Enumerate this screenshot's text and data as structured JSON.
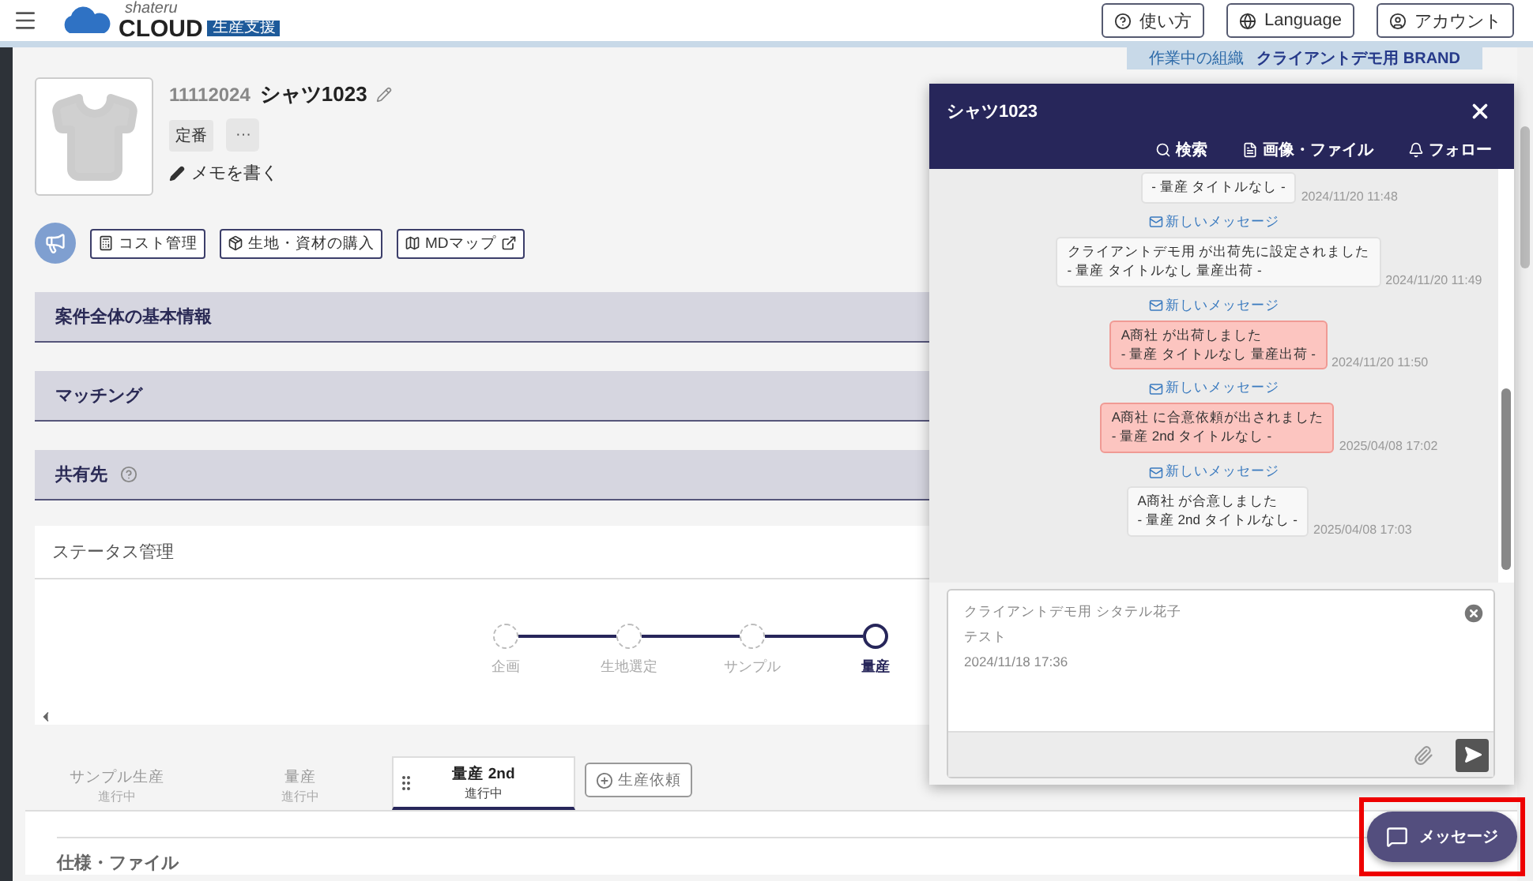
{
  "header": {
    "logo": {
      "small": "shateru",
      "main": "CLOUD",
      "badge": "生産支援"
    },
    "buttons": [
      {
        "kind": "help",
        "label": "使い方"
      },
      {
        "kind": "language",
        "label": "Language"
      },
      {
        "kind": "account",
        "label": "アカウント"
      }
    ]
  },
  "organization": {
    "label": "作業中の組織",
    "name": "クライアントデモ用 BRAND"
  },
  "product": {
    "code": "11112024",
    "name": "シャツ1023",
    "tag": "定番",
    "more": "···",
    "memo": "メモを書く"
  },
  "actions": [
    {
      "kind": "cost",
      "label": "コスト管理"
    },
    {
      "kind": "material",
      "label": "生地・資材の購入"
    },
    {
      "kind": "map",
      "label": "MDマップ"
    }
  ],
  "sections": [
    {
      "title": "案件全体の基本情報",
      "help": false
    },
    {
      "title": "マッチング",
      "help": false
    },
    {
      "title": "共有先",
      "help": true
    }
  ],
  "status": {
    "title": "ステータス管理",
    "steps": [
      {
        "label": "企画",
        "current": false
      },
      {
        "label": "生地選定",
        "current": false
      },
      {
        "label": "サンプル",
        "current": false
      },
      {
        "label": "量産",
        "current": true
      }
    ]
  },
  "phase_tabs": [
    {
      "title": "サンプル生産",
      "state": "進行中",
      "selected": false
    },
    {
      "title": "量産",
      "state": "進行中",
      "selected": false
    },
    {
      "title": "量産 2nd",
      "state": "進行中",
      "selected": true
    }
  ],
  "add_request": "生産依頼",
  "spec_title": "仕様・ファイル",
  "chat": {
    "title": "シャツ1023",
    "tools": [
      {
        "kind": "search",
        "label": "検索"
      },
      {
        "kind": "file",
        "label": "画像・ファイル"
      },
      {
        "kind": "follow",
        "label": "フォロー"
      }
    ],
    "messages": [
      {
        "kind": "normal",
        "text": "- 量産 タイトルなし -",
        "time": "2024/11/20 11:48"
      },
      {
        "kind": "normal",
        "notice": "新しいメッセージ",
        "text": "クライアントデモ用 が出荷先に設定されました\n- 量産 タイトルなし 量産出荷 -",
        "time": "2024/11/20 11:49"
      },
      {
        "kind": "alert",
        "notice": "新しいメッセージ",
        "text": "A商社 が出荷しました\n- 量産 タイトルなし 量産出荷 -",
        "time": "2024/11/20 11:50"
      },
      {
        "kind": "alert",
        "notice": "新しいメッセージ",
        "text": "A商社 に合意依頼が出されました\n- 量産 2nd タイトルなし -",
        "time": "2025/04/08 17:02"
      },
      {
        "kind": "normal",
        "notice": "新しいメッセージ",
        "text": "A商社 が合意しました\n- 量産 2nd タイトルなし -",
        "time": "2025/04/08 17:03"
      }
    ],
    "reply": {
      "sender": "クライアントデモ用 シタテル花子",
      "body": "テスト",
      "time": "2024/11/18 17:36"
    }
  },
  "message_button": "メッセージ"
}
